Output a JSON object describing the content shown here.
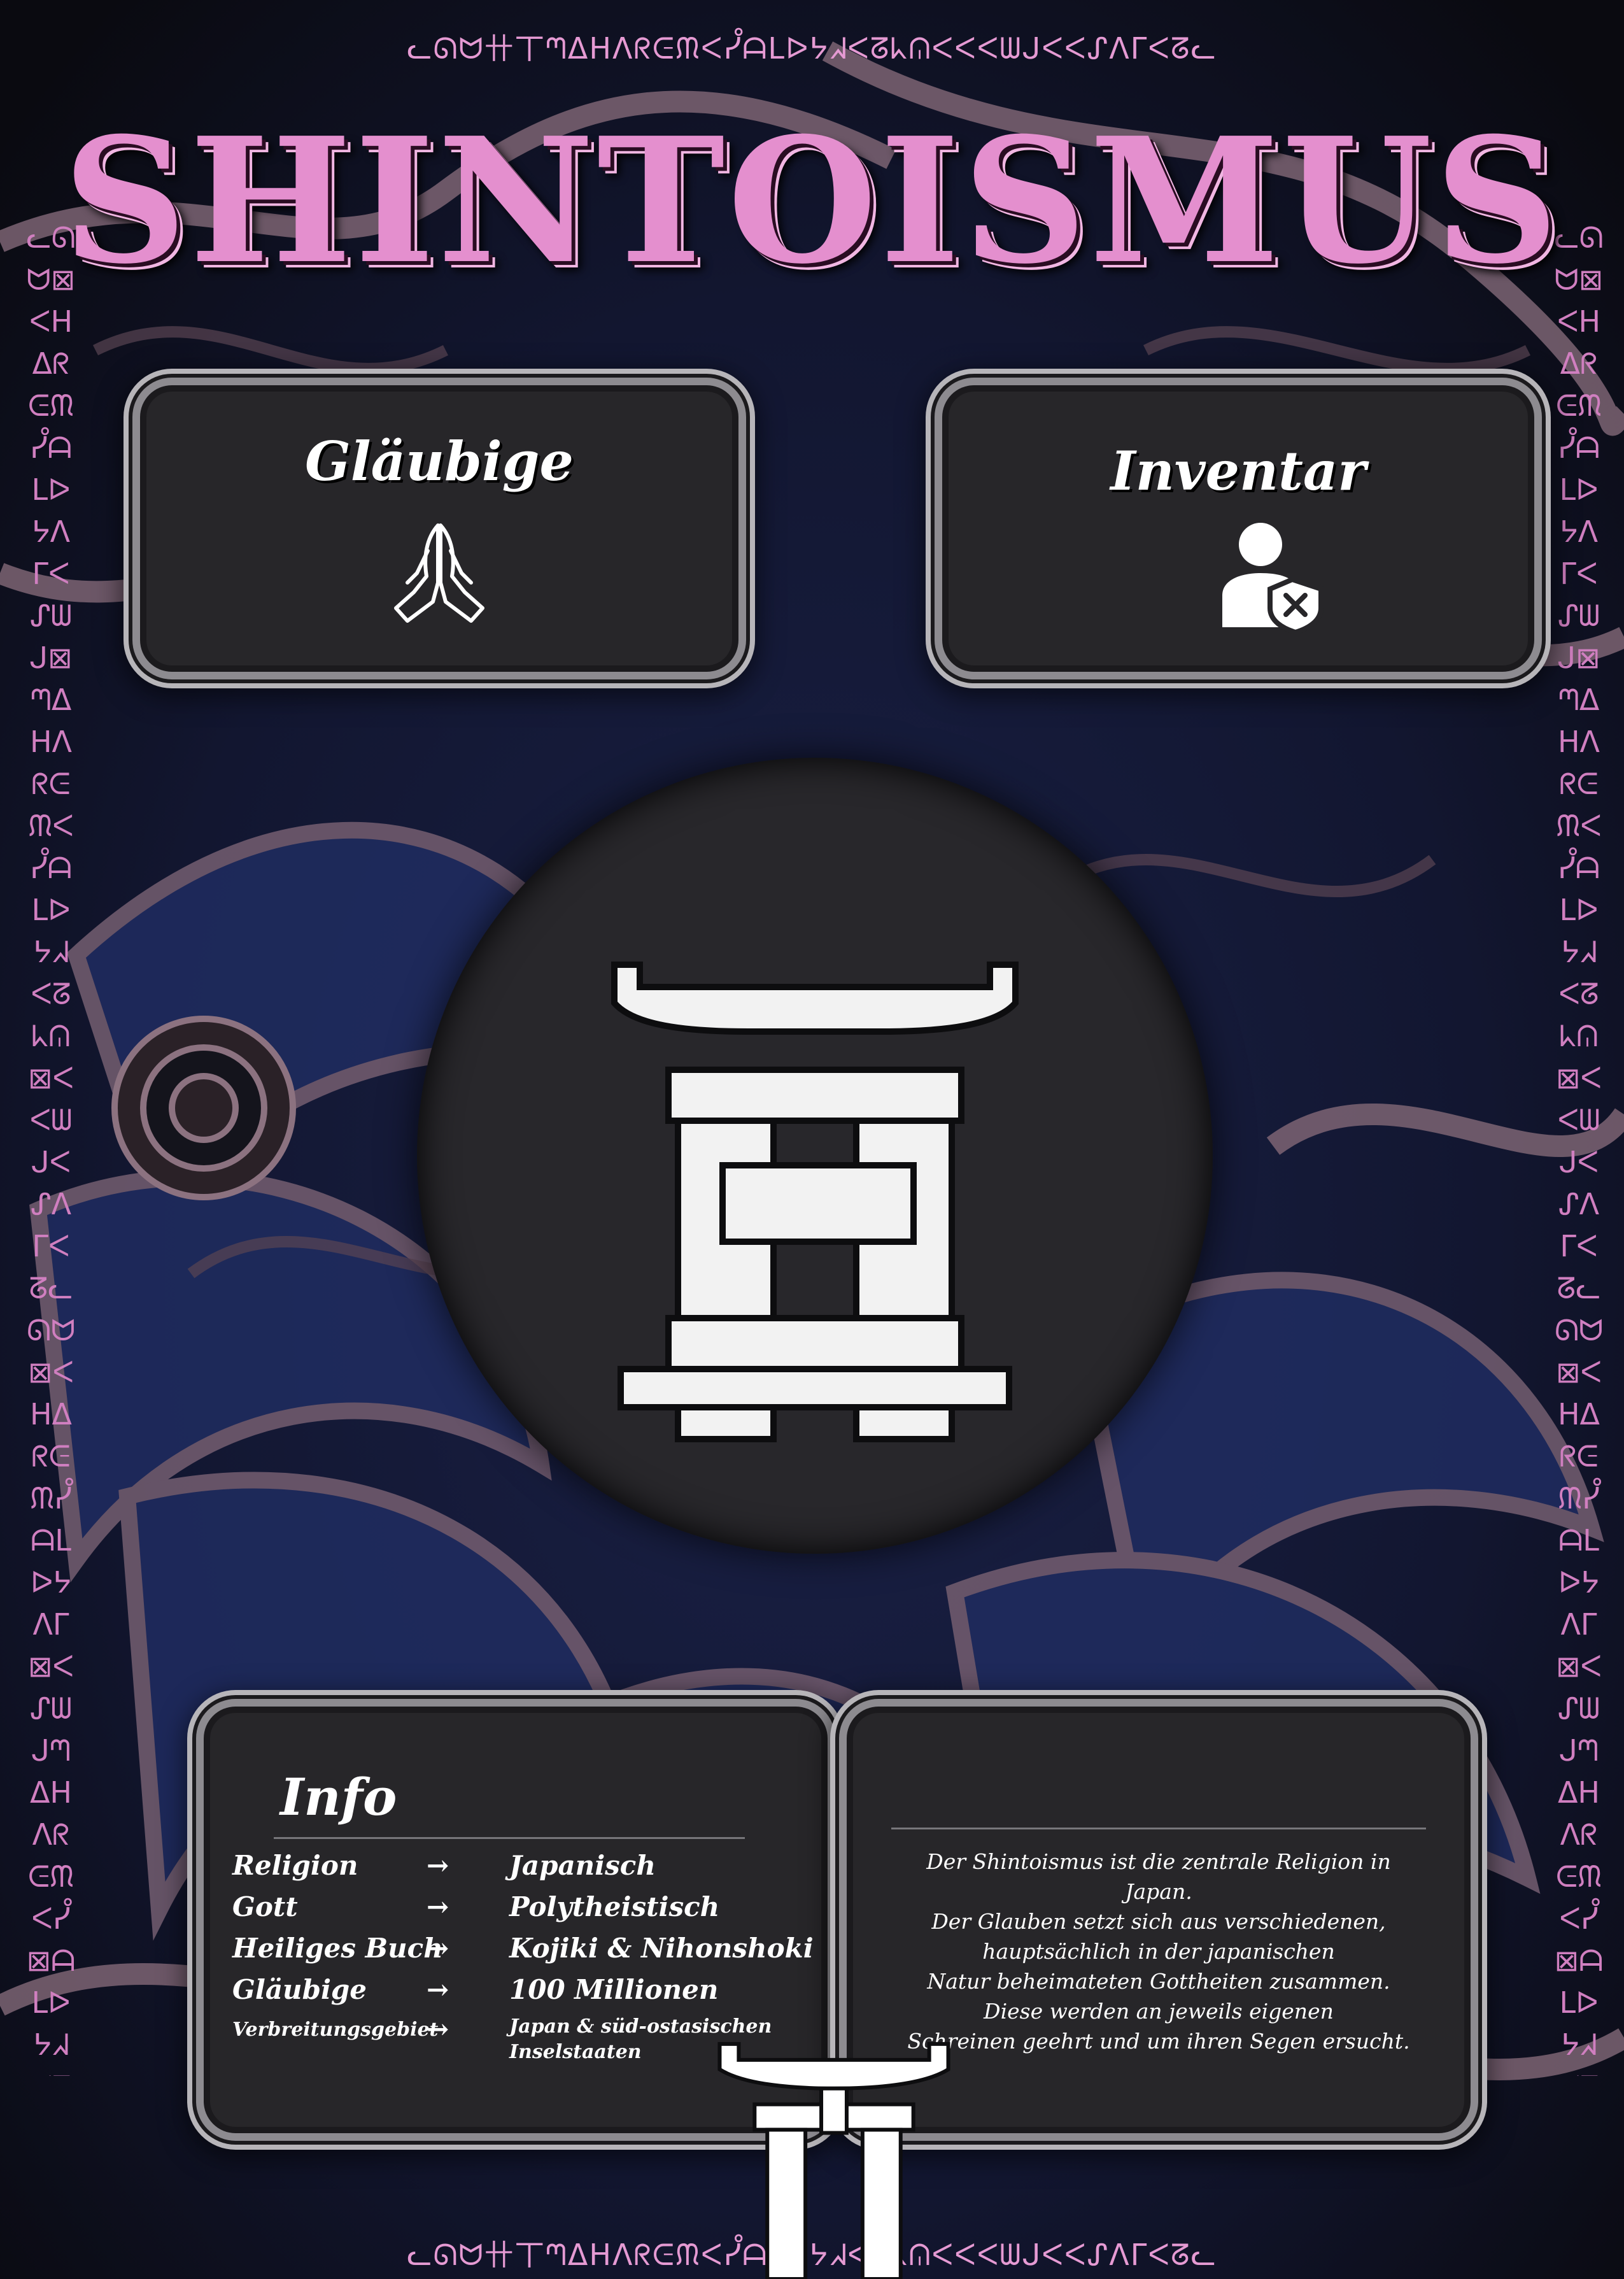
{
  "page": {
    "title": "SHINTOISMUS",
    "glyph_top": "ᓚᘏᗢ卄丅ᘉᐃᕼᐱᖇᕮᙏᐸᓮᗩᒪᐅᔭᖽᐸᘔᖾᕬᐸᐸᐸᗯᒍᐸᐸᔑᐱᒥᐸᘔᓚ",
    "glyph_bottom": "ᓚᘏᗢ卄丅ᘉᐃᕼᐱᖇᕮᙏᐸᓮᗩᒪᐅᔭᖽᐸᘔᖾᕬᐸᐸᐸᗯᒍᐸᐸᔑᐱᒥᐸᘔᓚ",
    "glyph_side": "ᓚᘏᗢ⊠ᐸᕼᐃᖇᕮᙏᓮᗩᒪᐅᔭᐱᒥᐸᔑᗯᒍ⊠ᘉᐃᕼᐱᖇᕮᙏᐸᓮᗩᒪᐅᔭᖽᐸᘔᖾᕬ⊠ᐸᐸᗯᒍᐸᔑᐱᒥᐸᘔᓚᘏᗢ⊠ᐸᕼᐃᖇᕮᙏᓮᗩᒪᐅᔭᐱᒥ⊠ᐸᔑᗯᒍᘉᐃᕼᐱᖇᕮᙏᐸᓮ⊠ᗩᒪᐅᔭᖽᐸᘔᖾᕬᐸᐸ⊠ᗯᒍᐸᔑᐱᒥᐸᘔᓚᘏᗢ⊠ᐸᕼᐃᖇᕮᙏᓮᗩᒪᐅᔭ⊠ᐱᒥᐸᔑᗯᒍ"
  },
  "cards": {
    "glaeubige": {
      "title": "Gläubige",
      "icon": "praying-hands-icon"
    },
    "inventar": {
      "title": "Inventar",
      "icon": "user-blocked-icon"
    }
  },
  "emblem": {
    "icon": "torii-gate-icon"
  },
  "info": {
    "title": "Info",
    "arrow": "→",
    "rows": [
      {
        "label": "Religion",
        "value": "Japanisch"
      },
      {
        "label": "Gott",
        "value": "Polytheistisch"
      },
      {
        "label": "Heiliges Buch",
        "value": "Kojiki & Nihonshoki"
      },
      {
        "label": "Gläubige",
        "value": "100 Millionen"
      },
      {
        "label": "Verbreitungsgebiet",
        "value_line1": "Japan & süd-ostasischen",
        "value_line2": "Inselstaaten"
      }
    ]
  },
  "description": {
    "lines": [
      "Der Shintoismus ist die zentrale Religion in Japan.",
      "Der Glauben setzt sich aus verschiedenen,",
      "hauptsächlich in der japanischen",
      "Natur beheimateten Gottheiten zusammen.",
      "Diese werden an jeweils eigenen",
      "Schreinen geehrt und um ihren Segen ersucht."
    ]
  },
  "colors": {
    "accent": "#e48fce",
    "panel": "#272629",
    "frame": "#8d8b90",
    "bg_blue": "#1f2a55",
    "bg_pink": "#7c6371"
  }
}
